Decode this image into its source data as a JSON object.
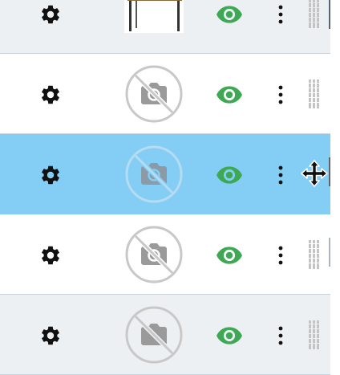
{
  "list": {
    "rows": [
      {
        "thumbnail": "table-image",
        "visible": true
      },
      {
        "thumbnail": "no-image-camera-icon",
        "visible": true
      },
      {
        "thumbnail": "no-image-camera-icon",
        "visible": true,
        "selected": true
      },
      {
        "thumbnail": "no-image-camera-icon",
        "visible": true
      },
      {
        "thumbnail": "no-image-camera-icon",
        "visible": true
      }
    ]
  },
  "colors": {
    "selected_row": "#84cdf5",
    "alt_row": "#edf0f3",
    "visible_eye": "#3fa854",
    "placeholder_stroke": "#c8c8c8"
  },
  "cursor": "move-cursor"
}
